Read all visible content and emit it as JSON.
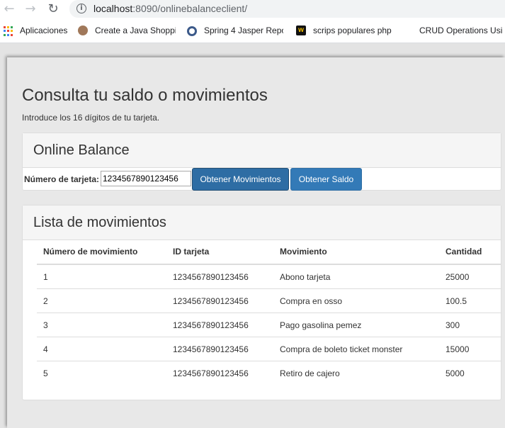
{
  "browser": {
    "url_host": "localhost",
    "url_rest": ":8090/onlinebalanceclient/",
    "bookmarks": [
      {
        "label": "Aplicaciones",
        "icon": "apps-grid-icon"
      },
      {
        "label": "Create a Java Shoppi",
        "icon": "java-bookmark-icon"
      },
      {
        "label": "Spring 4 Jasper Repo",
        "icon": "spring-bookmark-icon"
      },
      {
        "label": "scrips populares php",
        "icon": "php-bookmark-icon"
      },
      {
        "label": "CRUD Operations Usi",
        "icon": "crud-bookmark-icon"
      }
    ]
  },
  "page": {
    "title": "Consulta tu saldo o movimientos",
    "subtitle": "Introduce los 16 dígitos de tu tarjeta."
  },
  "balance_panel": {
    "heading": "Online Balance",
    "card_label": "Número de tarjeta:",
    "card_value": "1234567890123456",
    "btn_movimientos": "Obtener Movimientos",
    "btn_saldo": "Obtener Saldo"
  },
  "list_panel": {
    "heading": "Lista de movimientos",
    "headers": [
      "Número de movimiento",
      "ID tarjeta",
      "Movimiento",
      "Cantidad"
    ],
    "rows": [
      [
        "1",
        "1234567890123456",
        "Abono tarjeta",
        "25000"
      ],
      [
        "2",
        "1234567890123456",
        "Compra en osso",
        "100.5"
      ],
      [
        "3",
        "1234567890123456",
        "Pago gasolina pemez",
        "300"
      ],
      [
        "4",
        "1234567890123456",
        "Compra de boleto ticket monster",
        "15000"
      ],
      [
        "5",
        "1234567890123456",
        "Retiro de cajero",
        "5000"
      ]
    ]
  },
  "colors": {
    "btn_primary": "#2e6da4",
    "btn_info": "#337ab7"
  }
}
